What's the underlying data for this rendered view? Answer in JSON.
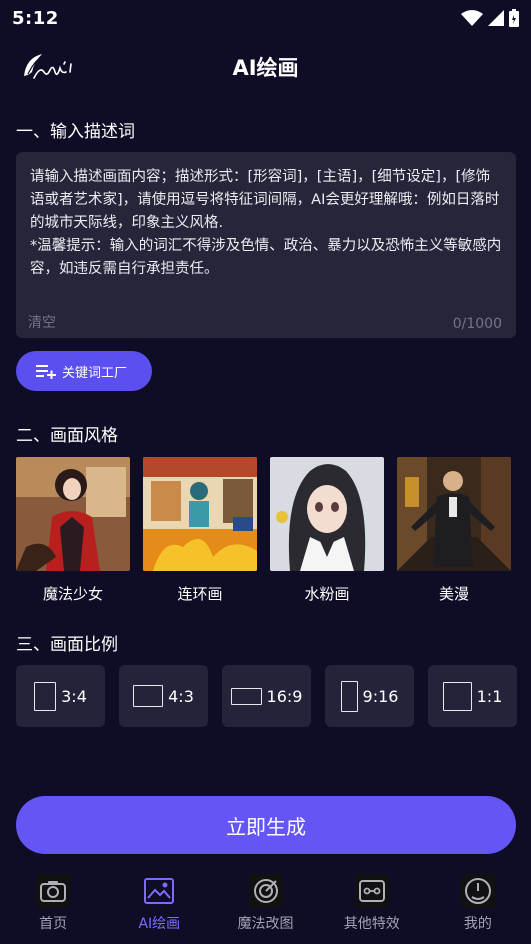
{
  "status_bar": {
    "time": "5:12"
  },
  "header": {
    "title": "AI绘画"
  },
  "prompt_section": {
    "title": "一、输入描述词",
    "text": "请输入描述画面内容；描述形式：[形容词]，[主语]，[细节设定]，[修饰语或者艺术家]，请使用逗号将特征词间隔，AI会更好理解哦：例如日落时的城市天际线，印象主义风格.\n*温馨提示：输入的词汇不得涉及色情、政治、暴力以及恐怖主义等敏感内容，如违反需自行承担责任。",
    "clear_label": "清空",
    "char_count": "0/1000",
    "keyword_button": "关键词工厂"
  },
  "style_section": {
    "title": "二、画面风格",
    "items": [
      {
        "label": "魔法少女"
      },
      {
        "label": "连环画"
      },
      {
        "label": "水粉画"
      },
      {
        "label": "美漫"
      }
    ]
  },
  "ratio_section": {
    "title": "三、画面比例",
    "items": [
      {
        "label": "3:4"
      },
      {
        "label": "4:3"
      },
      {
        "label": "16:9"
      },
      {
        "label": "9:16"
      },
      {
        "label": "1:1"
      }
    ]
  },
  "generate_button": "立即生成",
  "bottom_nav": [
    {
      "label": "首页",
      "icon": "camera-icon"
    },
    {
      "label": "AI绘画",
      "icon": "image-icon",
      "active": true
    },
    {
      "label": "魔法改图",
      "icon": "target-icon"
    },
    {
      "label": "其他特效",
      "icon": "effects-icon"
    },
    {
      "label": "我的",
      "icon": "profile-icon"
    }
  ],
  "colors": {
    "background": "#0f0c25",
    "accent": "#6455f5",
    "card": "#27253a",
    "active_nav": "#7b6cff"
  }
}
